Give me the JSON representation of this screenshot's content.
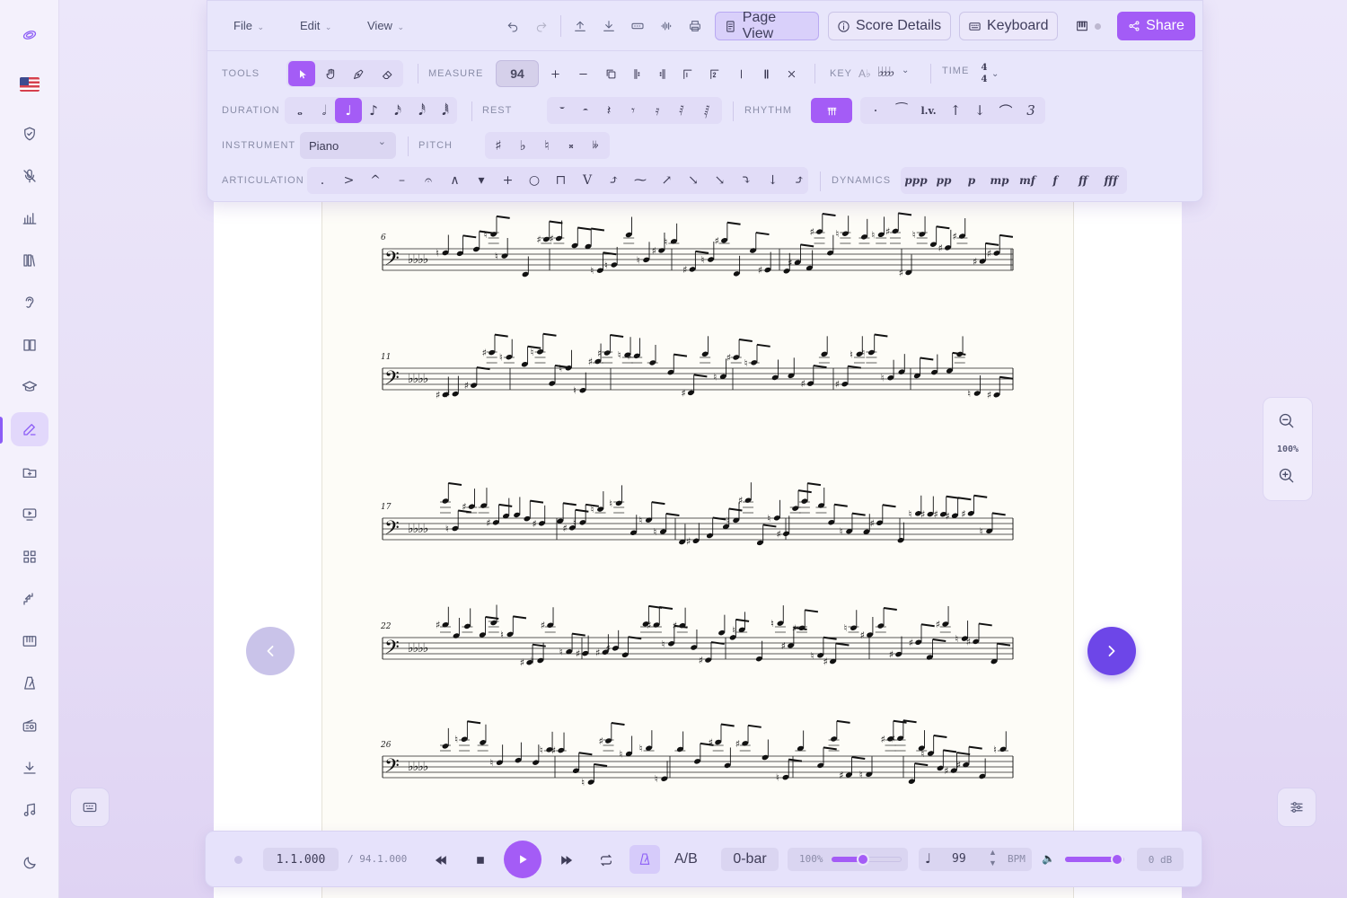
{
  "menu": {
    "file": "File",
    "edit": "Edit",
    "view": "View"
  },
  "topbar": {
    "page_view": "Page View",
    "score_details": "Score Details",
    "keyboard": "Keyboard",
    "share": "Share"
  },
  "toolbar": {
    "tools_label": "TOOLS",
    "measure_label": "MEASURE",
    "measure_value": "94",
    "key_label": "KEY",
    "key_value": "A♭",
    "time_label": "TIME",
    "time_num": "4",
    "time_den": "4",
    "duration_label": "DURATION",
    "rest_label": "REST",
    "rhythm_label": "RHYTHM",
    "instrument_label": "INSTRUMENT",
    "instrument_value": "Piano",
    "pitch_label": "PITCH",
    "articulation_label": "ARTICULATION",
    "dynamics_label": "DYNAMICS",
    "rhythm_items": [
      "·",
      "⁀",
      "l.v.",
      "↑",
      "↓",
      "⌒",
      "3"
    ],
    "pitch_items": [
      "♯",
      "♭",
      "♮",
      "𝄪",
      "𝄫"
    ],
    "articulation_items": [
      ".",
      ">",
      "^",
      "–",
      "𝄐",
      "∧",
      "▾",
      "+",
      "○",
      "⊓",
      "V",
      "⤴",
      "⁓",
      "↗",
      "↘",
      "↘",
      "⤵",
      "↓",
      "⤴"
    ],
    "dynamics_items": [
      "ppp",
      "pp",
      "p",
      "mp",
      "mf",
      "f",
      "ff",
      "fff"
    ]
  },
  "score": {
    "measure_numbers": [
      "6",
      "11",
      "17",
      "22",
      "26"
    ]
  },
  "zoom": {
    "value": "100%"
  },
  "transport": {
    "position": "1.1.000",
    "total": "/ 94.1.000",
    "ab": "A/B",
    "bar": "0-bar",
    "speed": "100%",
    "speed_fraction": 0.45,
    "tempo": "99",
    "bpm_label": "BPM",
    "volume_fraction": 0.88,
    "gain": "0 dB"
  },
  "icons": [
    "logo-icon",
    "flag-icon",
    "shield-icon",
    "microphone-icon",
    "chart-icon",
    "library-icon",
    "ear-icon",
    "book-icon",
    "graduation-icon",
    "edit-icon",
    "folder-icon",
    "monitor-icon",
    "grid-icon",
    "stairs-icon",
    "piano-icon",
    "metronome-icon",
    "radio-icon",
    "download-icon",
    "music-note-icon",
    "moon-icon"
  ],
  "colors": {
    "accent": "#a45cf6",
    "nav_next": "#6d46e8",
    "toolbar_bg": "#e8e6fb",
    "paper": "#fdfcf7"
  }
}
